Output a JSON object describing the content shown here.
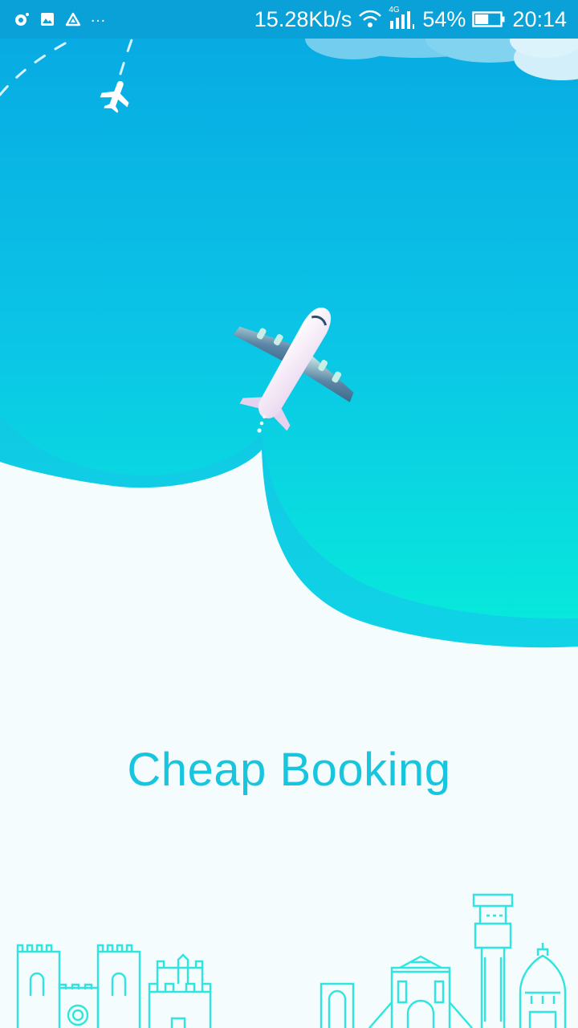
{
  "status_bar": {
    "network_speed": "15.28Kb/s",
    "network_type": "4G",
    "battery_percent": "54%",
    "battery_level": 0.54,
    "time": "20:14",
    "overflow_indicator": "…",
    "left_icons": [
      "sync-icon",
      "image-icon",
      "drive-icon"
    ],
    "right_icons": [
      "wifi-icon",
      "signal-icon",
      "battery-icon"
    ]
  },
  "app": {
    "title": "Cheap Booking"
  },
  "colors": {
    "status_bar": "#0aa1d8",
    "sky_top": "#07a9e2",
    "sky_bottom": "#0fd4e4",
    "background": "#f4fcfd",
    "title": "#17c6de",
    "skyline_outline": "#2ee6e0"
  }
}
